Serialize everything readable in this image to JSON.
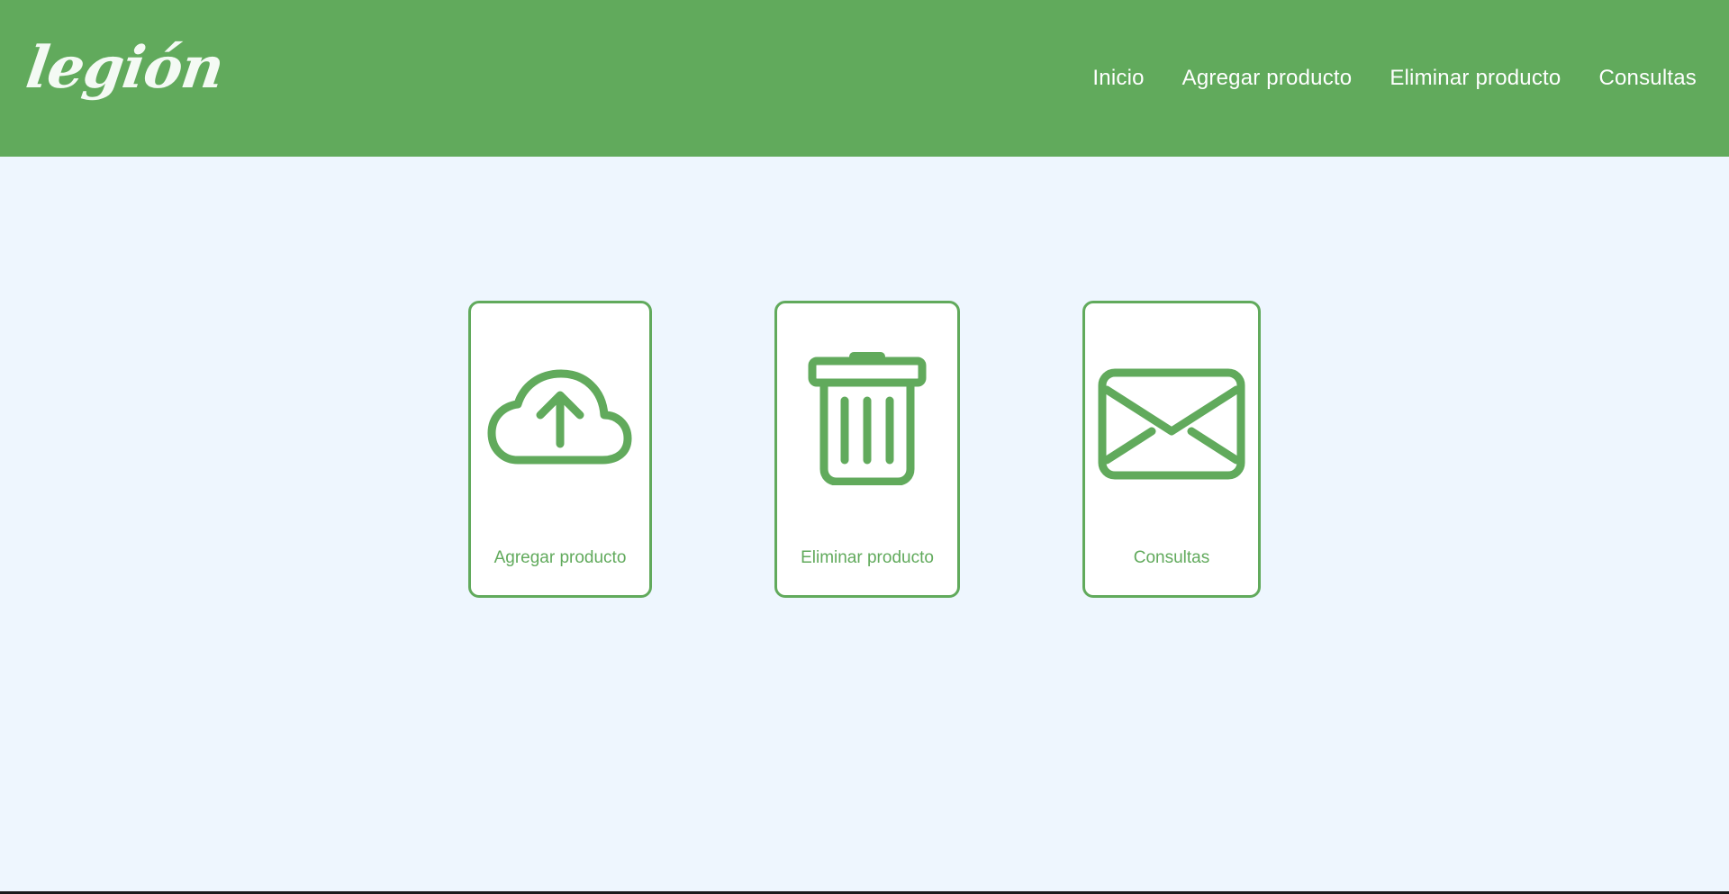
{
  "brand": {
    "logo": "legión"
  },
  "nav": {
    "items": [
      {
        "label": "Inicio"
      },
      {
        "label": "Agregar producto"
      },
      {
        "label": "Eliminar producto"
      },
      {
        "label": "Consultas"
      }
    ]
  },
  "cards": [
    {
      "label": "Agregar producto",
      "icon": "cloud-upload-icon"
    },
    {
      "label": "Eliminar producto",
      "icon": "trash-icon"
    },
    {
      "label": "Consultas",
      "icon": "envelope-icon"
    }
  ],
  "colors": {
    "accent": "#61aa5c",
    "background": "#eef6fe",
    "card": "#ffffff",
    "nav_text": "#ffffff"
  }
}
